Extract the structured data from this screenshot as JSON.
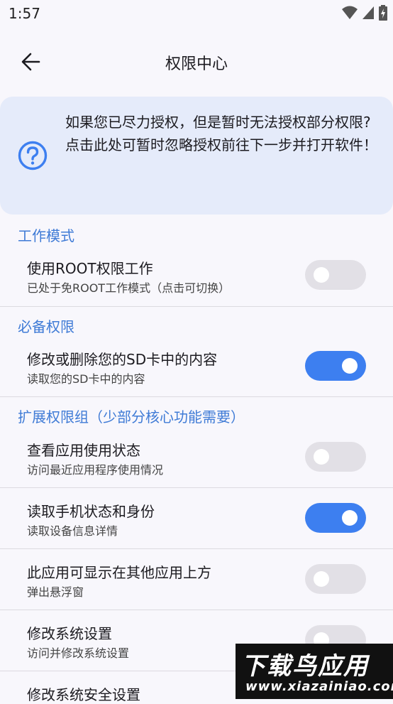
{
  "status_bar": {
    "time": "1:57"
  },
  "app_bar": {
    "title": "权限中心"
  },
  "notice": {
    "text": "如果您已尽力授权，但是暂时无法授权部分权限?\n点击此处可暂时忽略授权前往下一步并打开软件！"
  },
  "sections": {
    "work_mode": {
      "title": "工作模式",
      "items": [
        {
          "label": "使用ROOT权限工作",
          "sub": "已处于免ROOT工作模式（点击可切换）",
          "enabled": false
        }
      ]
    },
    "required": {
      "title": "必备权限",
      "items": [
        {
          "label": "修改或删除您的SD卡中的内容",
          "sub": "读取您的SD卡中的内容",
          "enabled": true
        }
      ]
    },
    "extended": {
      "title": "扩展权限组（少部分核心功能需要）",
      "items": [
        {
          "label": "查看应用使用状态",
          "sub": "访问最近应用程序使用情况",
          "enabled": false
        },
        {
          "label": "读取手机状态和身份",
          "sub": "读取设备信息详情",
          "enabled": true
        },
        {
          "label": "此应用可显示在其他应用上方",
          "sub": "弹出悬浮窗",
          "enabled": false
        },
        {
          "label": "修改系统设置",
          "sub": "访问并修改系统设置",
          "enabled": false
        },
        {
          "label": "修改系统安全设置",
          "sub": "",
          "enabled": false
        }
      ]
    }
  },
  "watermark": {
    "title": "下载鸟应用",
    "url": "www.xiazainiao.com"
  },
  "colors": {
    "accent": "#3d7ff0",
    "section": "#3f7bd6",
    "notice_bg": "#e5ebfa"
  }
}
